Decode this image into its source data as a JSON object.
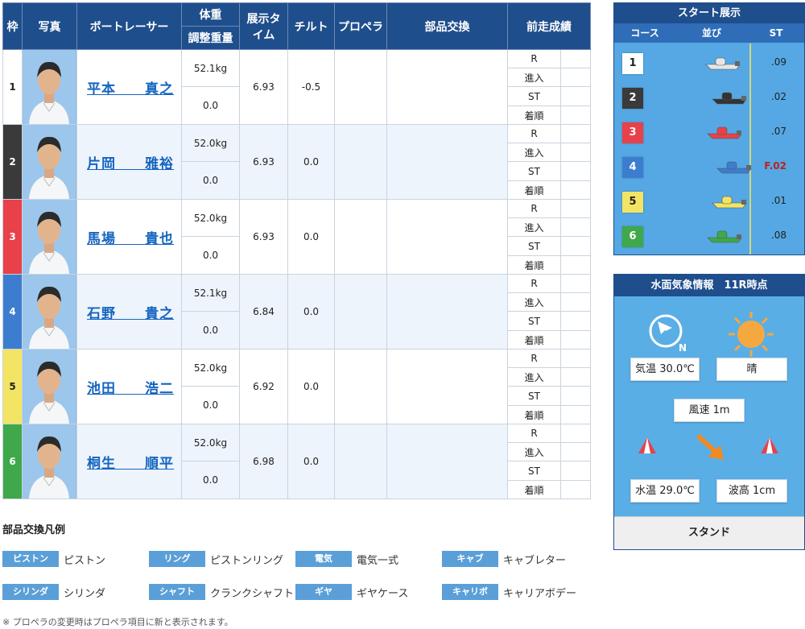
{
  "table": {
    "headers": {
      "waku": "枠",
      "photo": "写真",
      "racer": "ボートレーサー",
      "weight": "体重",
      "adjust": "調整重量",
      "ex_time": "展示タイム",
      "tilt": "チルト",
      "propeller": "プロペラ",
      "parts": "部品交換",
      "prev": "前走成績"
    },
    "result_labels": [
      "R",
      "進入",
      "ST",
      "着順"
    ],
    "racers": [
      {
        "waku": "1",
        "name": "平本　　真之",
        "weight": "52.1kg",
        "adjust": "0.0",
        "ex_time": "6.93",
        "tilt": "-0.5",
        "color": "#ffffff",
        "text": "#222222"
      },
      {
        "waku": "2",
        "name": "片岡　　雅裕",
        "weight": "52.0kg",
        "adjust": "0.0",
        "ex_time": "6.93",
        "tilt": "0.0",
        "color": "#3a3a3a",
        "text": "#ffffff"
      },
      {
        "waku": "3",
        "name": "馬場　　貴也",
        "weight": "52.0kg",
        "adjust": "0.0",
        "ex_time": "6.93",
        "tilt": "0.0",
        "color": "#e8414a",
        "text": "#ffffff"
      },
      {
        "waku": "4",
        "name": "石野　　貴之",
        "weight": "52.1kg",
        "adjust": "0.0",
        "ex_time": "6.84",
        "tilt": "0.0",
        "color": "#3d7dd0",
        "text": "#ffffff"
      },
      {
        "waku": "5",
        "name": "池田　　浩二",
        "weight": "52.0kg",
        "adjust": "0.0",
        "ex_time": "6.92",
        "tilt": "0.0",
        "color": "#f3e463",
        "text": "#222222"
      },
      {
        "waku": "6",
        "name": "桐生　　順平",
        "weight": "52.0kg",
        "adjust": "0.0",
        "ex_time": "6.98",
        "tilt": "0.0",
        "color": "#3fa84a",
        "text": "#ffffff"
      }
    ]
  },
  "legend": {
    "title": "部品交換凡例",
    "items": [
      {
        "chip": "ピストン",
        "label": "ピストン"
      },
      {
        "chip": "リング",
        "label": "ピストンリング"
      },
      {
        "chip": "電気",
        "label": "電気一式"
      },
      {
        "chip": "キャブ",
        "label": "キャブレター"
      },
      {
        "chip": "シリンダ",
        "label": "シリンダ"
      },
      {
        "chip": "シャフト",
        "label": "クランクシャフト"
      },
      {
        "chip": "ギヤ",
        "label": "ギヤケース"
      },
      {
        "chip": "キャリボ",
        "label": "キャリアボデー"
      }
    ],
    "note": "※ プロペラの変更時はプロペラ項目に新と表示されます。"
  },
  "start": {
    "title": "スタート展示",
    "headers": {
      "course": "コース",
      "order": "並び",
      "st": "ST"
    },
    "rows": [
      {
        "course": "1",
        "st": ".09",
        "color": "#ffffff",
        "text": "#222222",
        "boat": "#e6e6e6",
        "flying": false
      },
      {
        "course": "2",
        "st": ".02",
        "color": "#3a3a3a",
        "text": "#ffffff",
        "boat": "#333333",
        "flying": false
      },
      {
        "course": "3",
        "st": ".07",
        "color": "#e8414a",
        "text": "#ffffff",
        "boat": "#e8414a",
        "flying": false
      },
      {
        "course": "4",
        "st": "F.02",
        "color": "#3d7dd0",
        "text": "#ffffff",
        "boat": "#3d7dd0",
        "flying": true
      },
      {
        "course": "5",
        "st": ".01",
        "color": "#f3e463",
        "text": "#222222",
        "boat": "#f3e463",
        "flying": false
      },
      {
        "course": "6",
        "st": ".08",
        "color": "#3fa84a",
        "text": "#ffffff",
        "boat": "#3fa84a",
        "flying": false
      }
    ]
  },
  "weather": {
    "title": "水面気象情報　11R時点",
    "wind_dir_label": "N",
    "temp": "気温 30.0℃",
    "condition": "晴",
    "wind_speed": "風速 1m",
    "water_temp": "水温 29.0℃",
    "wave": "波高 1cm",
    "stand": "スタンド"
  }
}
